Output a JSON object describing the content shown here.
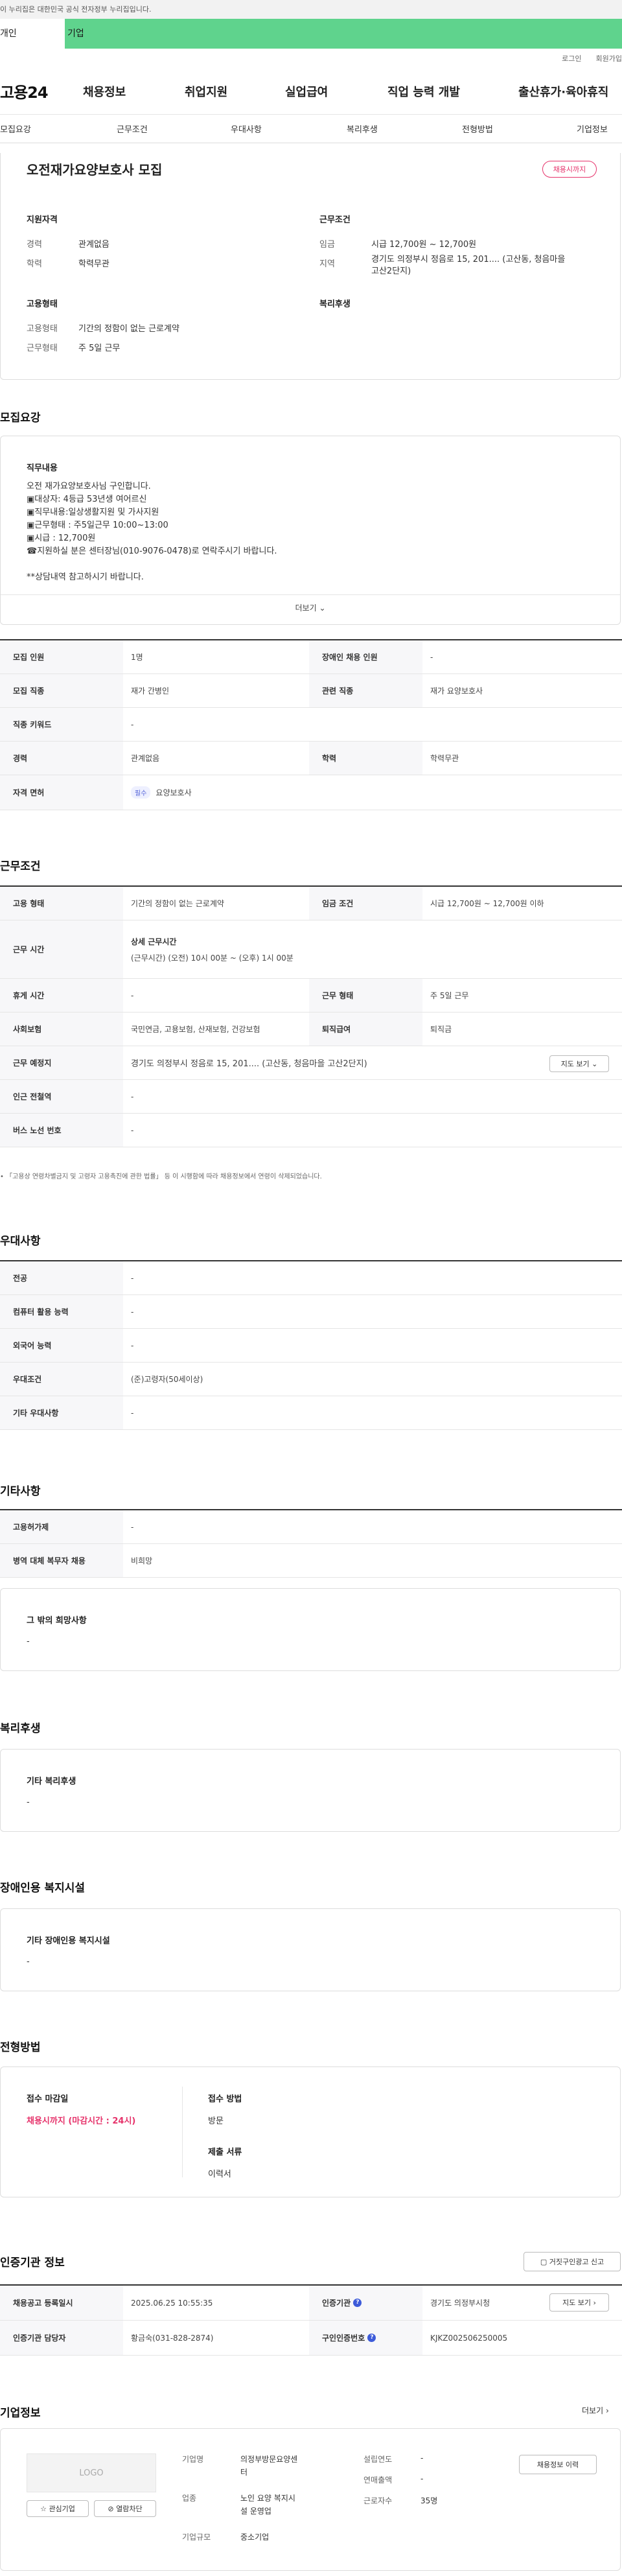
{
  "gov_banner": "이 누리집은 대한민국 공식 전자정부 누리집입니다.",
  "top_tabs": [
    "개인",
    "기업"
  ],
  "util_links": [
    "로그인",
    "회원가입"
  ],
  "logo": "고용24",
  "gnb": [
    "채용정보",
    "취업지원",
    "실업급여",
    "직업 능력 개발",
    "출산휴가·육아휴직"
  ],
  "subnav": [
    "모집요강",
    "근무조건",
    "우대사항",
    "복리후생",
    "전형방법",
    "기업정보"
  ],
  "summary": {
    "title": "오전재가요양보호사 모집",
    "badge": "채용시까지",
    "qual_title": "지원자격",
    "career_k": "경력",
    "career_v": "관계없음",
    "edu_k": "학력",
    "edu_v": "학력무관",
    "cond_title": "근무조건",
    "wage_k": "임금",
    "wage_v": "시급 12,700원 ~ 12,700원",
    "area_k": "지역",
    "area_v1": "경기도 의정부시 정음로 15, 201.... (고산동, 청음마을",
    "area_v2": "고산2단지)",
    "emp_title": "고용형태",
    "emptype_k": "고용형태",
    "emptype_v": "기간의 정함이 없는 근로계약",
    "worktype_k": "근무형태",
    "worktype_v": "주 5일 근무",
    "welfare_title": "복리후생"
  },
  "recruit": {
    "heading": "모집요강",
    "duty_title": "직무내용",
    "duty_lines": [
      "오전 재가요양보호사님 구인합니다.",
      "▣대상자: 4등급 53년생 여어르신",
      "▣직무내용:일상생활지원 및 가사지원",
      "▣근무형태 : 주5일근무 10:00~13:00",
      "▣시급 : 12,700원",
      "☎지원하실 분은 센터장님(010-9076-0478)로 연락주시기 바랍니다.",
      "",
      "**상담내역 참고하시기 바랍니다."
    ],
    "more": "더보기",
    "rows": {
      "count_k": "모집 인원",
      "count_v": "1명",
      "disabled_k": "장애인 채용 인원",
      "disabled_v": "-",
      "job_k": "모집 직종",
      "job_v": "재가 간병인",
      "related_k": "관련 직종",
      "related_v": "재가 요양보호사",
      "keyword_k": "직종 키워드",
      "keyword_v": "-",
      "career_k": "경력",
      "career_v": "관계없음",
      "edu_k": "학력",
      "edu_v": "학력무관",
      "license_k": "자격 면허",
      "license_tag": "필수",
      "license_v": "요양보호사"
    }
  },
  "work": {
    "heading": "근무조건",
    "emp_k": "고용 형태",
    "emp_v": "기간의 정함이 없는 근로계약",
    "wage_k": "임금 조건",
    "wage_v": "시급 12,700원 ~ 12,700원 이하",
    "time_k": "근무 시간",
    "time_sub": "상세 근무시간",
    "time_v": "(근무시간) (오전) 10시 00분 ~ (오후) 1시 00분",
    "rest_k": "휴게 시간",
    "rest_v": "-",
    "form_k": "근무 형태",
    "form_v": "주 5일 근무",
    "insure_k": "사회보험",
    "insure_v": "국민연금, 고용보험, 산재보험, 건강보험",
    "retire_k": "퇴직급여",
    "retire_v": "퇴직금",
    "place_k": "근무 예정지",
    "place_v": "경기도 의정부시 정음로 15, 201.... (고산동, 청음마을 고산2단지)",
    "map_btn": "지도 보기",
    "station_k": "인근 전철역",
    "station_v": "-",
    "bus_k": "버스 노선 번호",
    "bus_v": "-",
    "note": "「고용상 연령차별금지 및 고령자 고용촉진에 관한 법률」 등 이 시행함에 따라 채용정보에서 연령이 삭제되었습니다."
  },
  "prefer": {
    "heading": "우대사항",
    "major_k": "전공",
    "major_v": "-",
    "pc_k": "컴퓨터 활용 능력",
    "pc_v": "-",
    "lang_k": "외국어 능력",
    "lang_v": "-",
    "cond_k": "우대조건",
    "cond_v": "(준)고령자(50세이상)",
    "etc_k": "기타 우대사항",
    "etc_v": "-"
  },
  "other": {
    "heading": "기타사항",
    "lab_k": "고용허가제",
    "lab_v": "-",
    "mil_k": "병역 대체 복무자 채용",
    "mil_v": "비희망",
    "wish_title": "그 밖의 희망사항",
    "wish_v": "-"
  },
  "welfare": {
    "heading": "복리후생",
    "title": "기타 복리후생",
    "v": "-"
  },
  "disabled": {
    "heading": "장애인용 복지시설",
    "title": "기타 장애인용 복지시설",
    "v": "-"
  },
  "process": {
    "heading": "전형방법",
    "deadline_title": "접수 마감일",
    "deadline_v": "채용시까지 (마감시간 : 24시)",
    "method_title": "접수 방법",
    "method_v": "방문",
    "docs_title": "제출 서류",
    "docs_v": "이력서"
  },
  "agency": {
    "heading": "인증기관 정보",
    "report_btn": "거짓구인광고 신고",
    "reg_k": "채용공고 등록일시",
    "reg_v": "2025.06.25 10:55:35",
    "org_k": "인증기관",
    "org_v": "경기도 의정부시청",
    "mgr_k": "인증기관 담당자",
    "mgr_v": "황금숙(031-828-2874)",
    "auth_k": "구인인증번호",
    "auth_v": "KJKZ002506250005",
    "map_btn": "지도 보기"
  },
  "company": {
    "heading": "기업정보",
    "more": "더보기",
    "logo": "LOGO",
    "fav_btn": "관심기업",
    "block_btn": "열람차단",
    "name_k": "기업명",
    "name_v1": "의정부방문요양센",
    "name_v2": "터",
    "ind_k": "업종",
    "ind_v1": "노인 요양 복지시",
    "ind_v2": "설 운영업",
    "size_k": "기업규모",
    "size_v": "중소기업",
    "year_k": "설립연도",
    "year_v": "-",
    "sales_k": "연매출액",
    "sales_v": "-",
    "emp_k": "근로자수",
    "emp_v": "35명",
    "hist_btn": "채용정보 이력"
  }
}
